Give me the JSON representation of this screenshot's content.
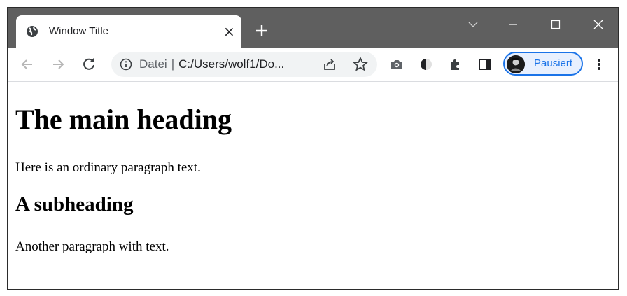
{
  "tab": {
    "title": "Window Title",
    "close_symbol": "×"
  },
  "toolbar": {
    "address_scheme_label": "Datei",
    "address_url": "C:/Users/wolf1/Do...",
    "profile_status": "Pausiert"
  },
  "icons": {
    "favicon": "globe-icon",
    "new_tab": "plus-icon",
    "back": "arrow-left-icon",
    "forward": "arrow-right-icon",
    "reload": "reload-icon",
    "info": "info-icon",
    "share": "share-icon",
    "bookmark": "star-icon",
    "screenshot": "camera-icon",
    "dark_mode": "contrast-icon",
    "extensions": "puzzle-icon",
    "side_panel": "side-panel-icon",
    "menu": "kebab-menu-icon"
  },
  "page": {
    "heading": "The main heading",
    "paragraph1": "Here is an ordinary paragraph text.",
    "subheading": "A subheading",
    "paragraph2": "Another paragraph with text."
  },
  "colors": {
    "tabstrip": "#5f5f5f",
    "accent": "#1a73e8",
    "omnibox": "#f1f3f4"
  }
}
